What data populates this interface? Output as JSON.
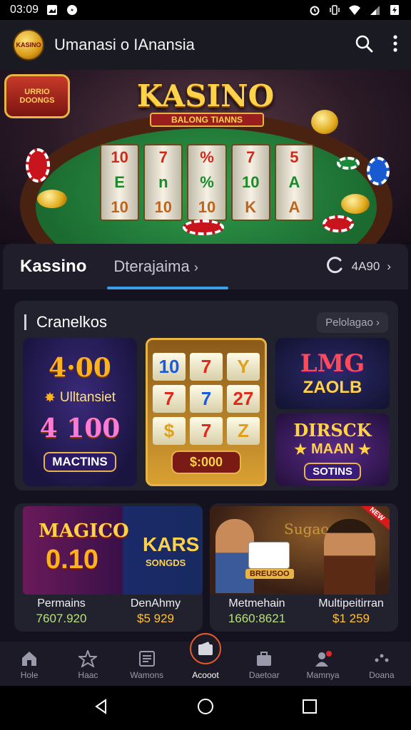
{
  "status_bar": {
    "time": "03:09"
  },
  "app_bar": {
    "title": "Umanasi o IAnansia",
    "logo_text": "KASINO"
  },
  "hero": {
    "title": "KASINO",
    "subtitle": "BALONG TIANNS",
    "sign_text": "URRIO DOONGS",
    "reels": [
      [
        "10",
        "E",
        "10"
      ],
      [
        "7",
        "n",
        "10"
      ],
      [
        "%",
        "%",
        "10"
      ],
      [
        "7",
        "10",
        "K"
      ],
      [
        "5",
        "A",
        "A"
      ]
    ]
  },
  "tabs": {
    "main": "Kassino",
    "secondary": "Dterajaima",
    "right_value": "4A90"
  },
  "section": {
    "title": "Cranelkos",
    "more": "Pelolagao",
    "game1": {
      "top_number": "4·00",
      "badge": "Ulltansiet",
      "mid_number": "4 100",
      "label": "MACTINS"
    },
    "game2": {
      "symbols": [
        "10",
        "7",
        "Y",
        "7",
        "7",
        "27",
        "$",
        "7",
        "Z"
      ],
      "price": "$:000"
    },
    "game3": {
      "line1": "LMG",
      "line2": "ZAOLB"
    },
    "game4": {
      "line1": "DIRSCK",
      "line2": "MAAN",
      "label": "SOTINS"
    }
  },
  "promos": [
    {
      "image_title": "MAGICO",
      "image_number": "0.10",
      "side_title": "KARS",
      "side_sub": "SONGDS",
      "col1_label": "Permains",
      "col1_value": "7607.920",
      "col2_label": "DenAhmy",
      "col2_value": "$5 929"
    },
    {
      "image_title": "Sugao",
      "card_label": "BREUSOO",
      "badge": "NEW",
      "col1_label": "Metmehain",
      "col1_value": "1660:8621",
      "col2_label": "Multipeitirran",
      "col2_value": "$1 259"
    }
  ],
  "bottom_nav": [
    {
      "label": "Hole",
      "icon": "home-icon"
    },
    {
      "label": "Haac",
      "icon": "star-icon"
    },
    {
      "label": "Wamons",
      "icon": "receipt-icon"
    },
    {
      "label": "Acooot",
      "icon": "wallet-icon"
    },
    {
      "label": "Daetoar",
      "icon": "briefcase-icon"
    },
    {
      "label": "Mamnya",
      "icon": "profile-icon"
    },
    {
      "label": "Doana",
      "icon": "more-icon"
    }
  ]
}
